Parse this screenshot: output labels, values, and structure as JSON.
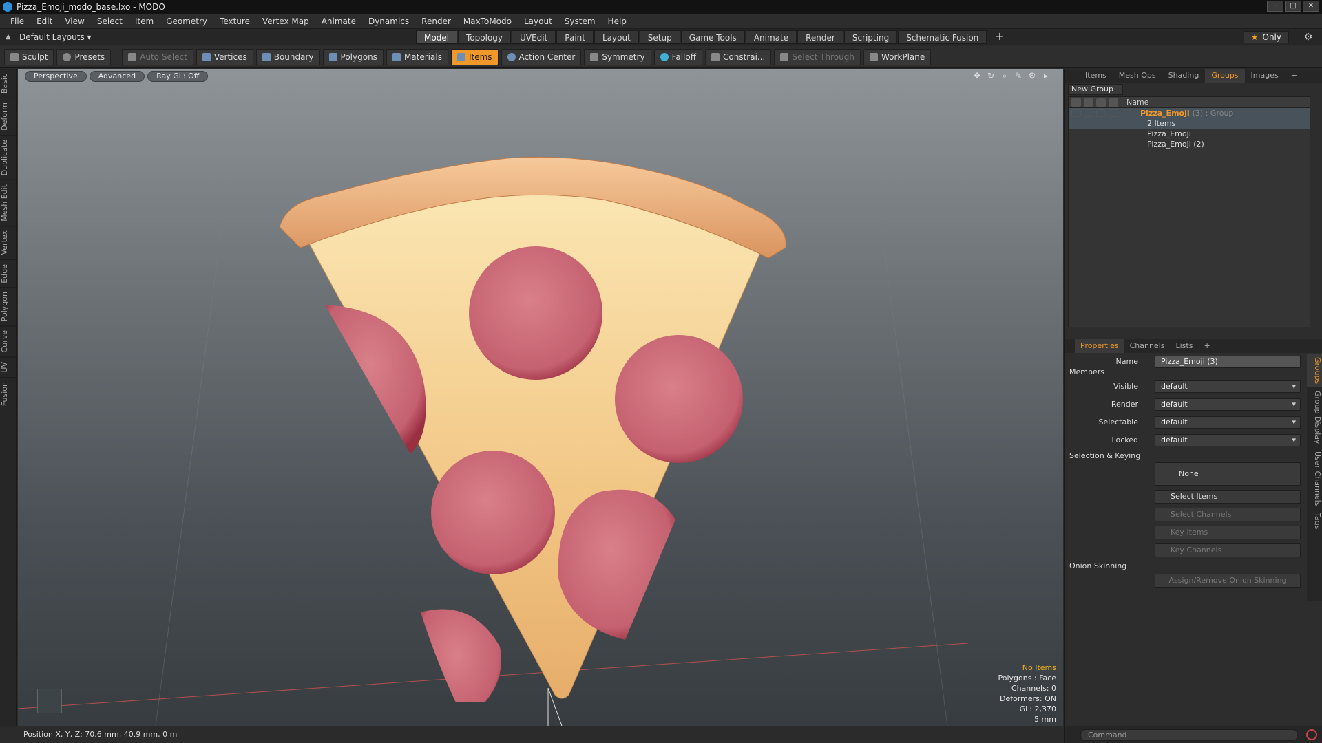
{
  "window": {
    "title": "Pizza_Emoji_modo_base.lxo - MODO",
    "buttons": [
      "–",
      "□",
      "✕"
    ]
  },
  "menu": [
    "File",
    "Edit",
    "View",
    "Select",
    "Item",
    "Geometry",
    "Texture",
    "Vertex Map",
    "Animate",
    "Dynamics",
    "Render",
    "MaxToModo",
    "Layout",
    "System",
    "Help"
  ],
  "layout_selector": "Default Layouts ▾",
  "mode_tabs": [
    "Model",
    "Topology",
    "UVEdit",
    "Paint",
    "Layout",
    "Setup",
    "Game Tools",
    "Animate",
    "Render",
    "Scripting",
    "Schematic Fusion"
  ],
  "mode_active": "Model",
  "only_label": "Only",
  "toolbar": {
    "sculpt": "Sculpt",
    "presets": "Presets",
    "auto_select": "Auto Select",
    "vertices": "Vertices",
    "boundary": "Boundary",
    "polygons": "Polygons",
    "materials": "Materials",
    "items": "Items",
    "action_center": "Action Center",
    "symmetry": "Symmetry",
    "falloff": "Falloff",
    "constraints": "Constrai...",
    "select_through": "Select Through",
    "workplane": "WorkPlane"
  },
  "left_tabs": [
    "Basic",
    "Deform",
    "Duplicate",
    "Mesh Edit",
    "Vertex",
    "Edge",
    "Polygon",
    "Curve",
    "UV",
    "Fusion"
  ],
  "viewport": {
    "perspective": "Perspective",
    "advanced": "Advanced",
    "raygl": "Ray GL: Off",
    "stats": {
      "no_items": "No Items",
      "polygons": "Polygons : Face",
      "channels": "Channels: 0",
      "deformers": "Deformers: ON",
      "gl": "GL: 2,370",
      "scale": "5 mm"
    }
  },
  "status": "Position X, Y, Z:  70.6 mm, 40.9 mm, 0 m",
  "panel_tabs": [
    "Items",
    "Mesh Ops",
    "Shading",
    "Groups",
    "Images"
  ],
  "panel_active": "Groups",
  "new_group": "New Group",
  "tree": {
    "header": "Name",
    "group_name": "Pizza_Emoji",
    "group_suffix": "(3) : Group",
    "group_count": "2 Items",
    "child1": "Pizza_Emoji",
    "child2": "Pizza_Emoji (2)"
  },
  "prop_tabs": [
    "Properties",
    "Channels",
    "Lists"
  ],
  "prop_active": "Properties",
  "properties": {
    "name_label": "Name",
    "name_value": "Pizza_Emoji (3)",
    "members": "Members",
    "visible_label": "Visible",
    "visible_value": "default",
    "render_label": "Render",
    "render_value": "default",
    "selectable_label": "Selectable",
    "selectable_value": "default",
    "locked_label": "Locked",
    "locked_value": "default",
    "selection_keying": "Selection & Keying",
    "none": "None",
    "select_items": "Select Items",
    "select_channels": "Select Channels",
    "key_items": "Key Items",
    "key_channels": "Key Channels",
    "onion": "Onion Skinning",
    "assign_onion": "Assign/Remove Onion Skinning"
  },
  "right_vtabs": [
    "Groups",
    "Group Display",
    "User Channels",
    "Tags"
  ],
  "command_placeholder": "Command"
}
